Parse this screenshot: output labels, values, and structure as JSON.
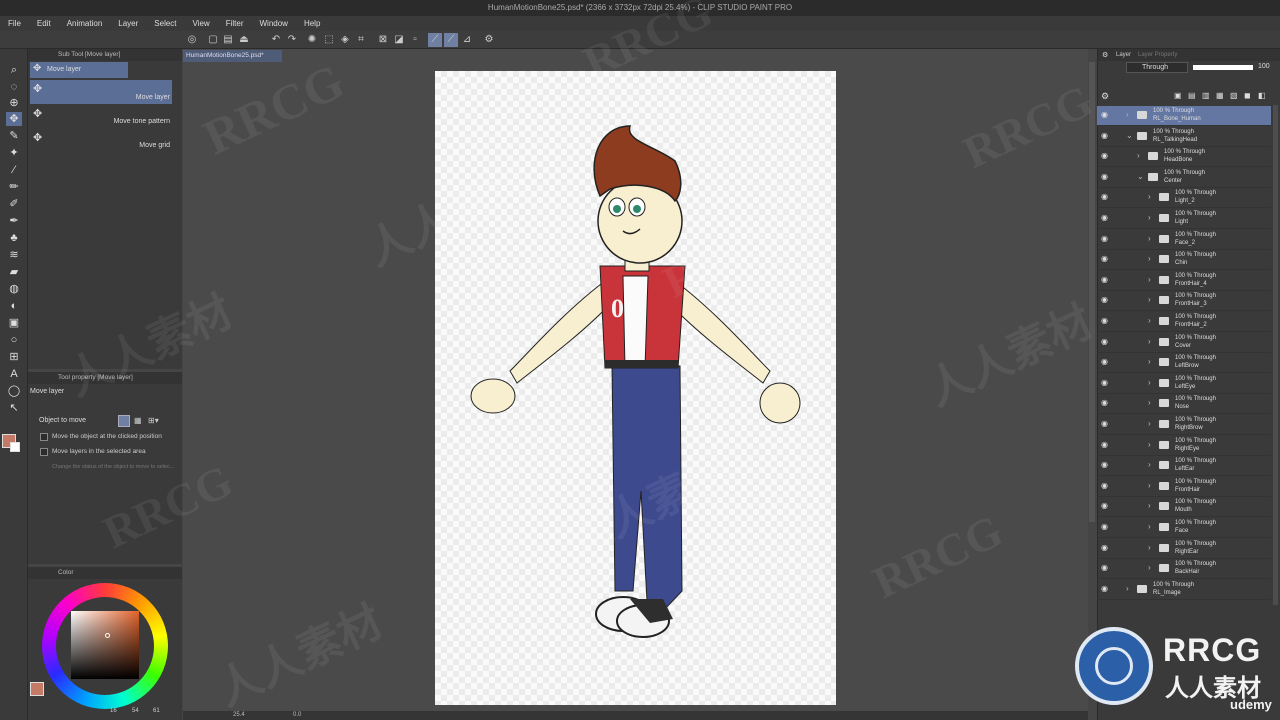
{
  "window": {
    "title": "HumanMotionBone25.psd* (2366 x 3732px 72dpi 25.4%)  - CLIP STUDIO PAINT PRO"
  },
  "menu": [
    "File",
    "Edit",
    "Animation",
    "Layer",
    "Select",
    "View",
    "Filter",
    "Window",
    "Help"
  ],
  "subtool": {
    "header": "Sub Tool [Move layer]",
    "selected_label": "Move layer",
    "items": [
      "Move layer",
      "Move tone pattern",
      "Move grid"
    ]
  },
  "tool_property": {
    "header": "Tool property [Move layer]",
    "title": "Move layer",
    "object_to_move_label": "Object to move",
    "options": [
      {
        "label": "Move the object at the clicked position",
        "checked": false
      },
      {
        "label": "Move layers in the selected area",
        "checked": false
      }
    ],
    "hint": "Change the status of the object to move to selec..."
  },
  "color_panel": {
    "header": "Color",
    "main_color": "#c47a66",
    "sub_color": "#ffffff",
    "values": [
      "16",
      "54",
      "61"
    ]
  },
  "document_tab": "HumanMotionBone25.psd*",
  "status": {
    "zoom": "25.4",
    "angle": "0.0"
  },
  "layer_panel": {
    "tab_layer": "Layer",
    "tab_other": "Layer Property",
    "blend_mode": "Through",
    "opacity": "100",
    "layers": [
      {
        "mode": "100 % Through",
        "name": "RL_Bone_Human",
        "indent": 0,
        "expanded": false,
        "selected": true
      },
      {
        "mode": "100 % Through",
        "name": "RL_TalkingHead",
        "indent": 0,
        "expanded": true,
        "selected": false
      },
      {
        "mode": "100 % Through",
        "name": "HeadBone",
        "indent": 1,
        "expanded": false,
        "selected": false
      },
      {
        "mode": "100 % Through",
        "name": "Center",
        "indent": 1,
        "expanded": true,
        "selected": false
      },
      {
        "mode": "100 % Through",
        "name": "Light_2",
        "indent": 2,
        "expanded": false,
        "selected": false
      },
      {
        "mode": "100 % Through",
        "name": "Light",
        "indent": 2,
        "expanded": false,
        "selected": false
      },
      {
        "mode": "100 % Through",
        "name": "Face_2",
        "indent": 2,
        "expanded": false,
        "selected": false
      },
      {
        "mode": "100 % Through",
        "name": "Chin",
        "indent": 2,
        "expanded": false,
        "selected": false
      },
      {
        "mode": "100 % Through",
        "name": "FrontHair_4",
        "indent": 2,
        "expanded": false,
        "selected": false
      },
      {
        "mode": "100 % Through",
        "name": "FrontHair_3",
        "indent": 2,
        "expanded": false,
        "selected": false
      },
      {
        "mode": "100 % Through",
        "name": "FrontHair_2",
        "indent": 2,
        "expanded": false,
        "selected": false
      },
      {
        "mode": "100 % Through",
        "name": "Cover",
        "indent": 2,
        "expanded": false,
        "selected": false
      },
      {
        "mode": "100 % Through",
        "name": "LeftBrow",
        "indent": 2,
        "expanded": false,
        "selected": false
      },
      {
        "mode": "100 % Through",
        "name": "LeftEye",
        "indent": 2,
        "expanded": false,
        "selected": false
      },
      {
        "mode": "100 % Through",
        "name": "Nose",
        "indent": 2,
        "expanded": false,
        "selected": false
      },
      {
        "mode": "100 % Through",
        "name": "RightBrow",
        "indent": 2,
        "expanded": false,
        "selected": false
      },
      {
        "mode": "100 % Through",
        "name": "RightEye",
        "indent": 2,
        "expanded": false,
        "selected": false
      },
      {
        "mode": "100 % Through",
        "name": "LeftEar",
        "indent": 2,
        "expanded": false,
        "selected": false
      },
      {
        "mode": "100 % Through",
        "name": "FrontHair",
        "indent": 2,
        "expanded": false,
        "selected": false
      },
      {
        "mode": "100 % Through",
        "name": "Mouth",
        "indent": 2,
        "expanded": false,
        "selected": false
      },
      {
        "mode": "100 % Through",
        "name": "Face",
        "indent": 2,
        "expanded": false,
        "selected": false
      },
      {
        "mode": "100 % Through",
        "name": "RightEar",
        "indent": 2,
        "expanded": false,
        "selected": false
      },
      {
        "mode": "100 % Through",
        "name": "BackHair",
        "indent": 2,
        "expanded": false,
        "selected": false
      },
      {
        "mode": "100 % Through",
        "name": "RL_Image",
        "indent": 0,
        "expanded": false,
        "selected": false
      }
    ]
  },
  "watermarks": {
    "latin": "RRCG",
    "cjk": "人人素材",
    "brand_top": "RRCG",
    "brand_bottom": "人人素材",
    "udemy": "udemy"
  },
  "icons": {
    "eye": "eye-icon",
    "folder": "folder-icon",
    "move": "move-icon"
  }
}
